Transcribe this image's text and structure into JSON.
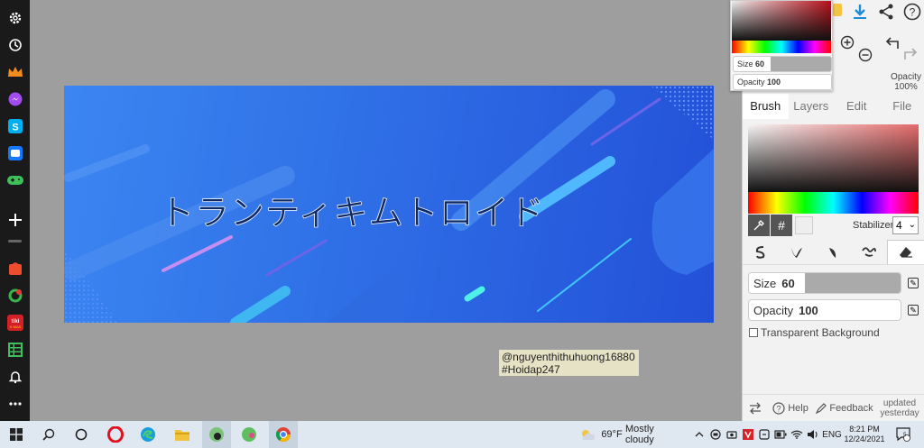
{
  "colors": {
    "dock_bg": "#1a1a1a",
    "canvas_bg": "#9e9e9e",
    "accent_blue": "#1a8cd8",
    "banner_start": "#3b86f2",
    "banner_end": "#2350d8"
  },
  "dock": {
    "items": [
      "gear-icon",
      "history-icon",
      "crown-icon",
      "messenger-icon",
      "skype-icon",
      "zalo-icon",
      "gamepad-icon",
      "plus-icon",
      "shopee-icon",
      "chrome-badge-icon",
      "tiki-icon",
      "table-icon",
      "bell-icon",
      "more-icon"
    ]
  },
  "canvas": {
    "title_text": "トランティキムトロイド",
    "note_line1": "@nguyenthithuhuong16880",
    "note_line2": "#Hoidap247"
  },
  "panel": {
    "opacity_label": "Opacity",
    "opacity_value": "100%",
    "tabs": [
      "Brush",
      "Layers",
      "Edit",
      "File"
    ],
    "active_tab": "Brush",
    "hash_symbol": "#",
    "stabilizer_label": "Stabilizer",
    "stabilizer_value": "4",
    "size_label": "Size",
    "size_value": "60",
    "opacity_slider_label": "Opacity",
    "opacity_slider_value": "100",
    "transparent_bg_label": "Transparent Background",
    "help_label": "Help",
    "feedback_label": "Feedback",
    "updated_line1": "updated",
    "updated_line2": "yesterday"
  },
  "popup": {
    "size_label": "Size",
    "size_value": "60",
    "opacity_label": "Opacity",
    "opacity_value": "100"
  },
  "taskbar": {
    "weather_temp": "69°F",
    "weather_desc": "Mostly cloudy",
    "lang": "ENG",
    "time": "8:21 PM",
    "date": "12/24/2021",
    "notif_count": "5"
  }
}
